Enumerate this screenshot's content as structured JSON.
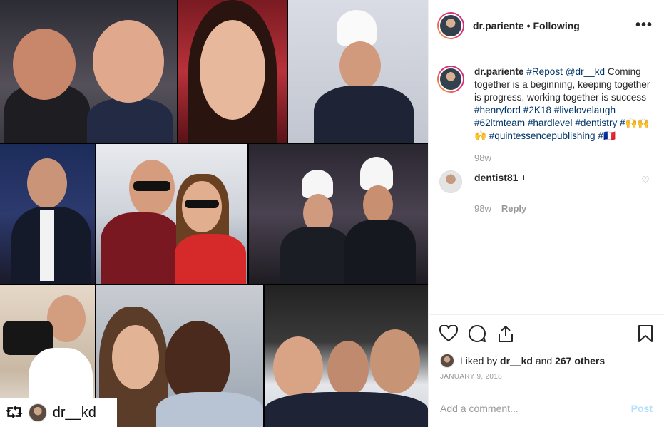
{
  "photo": {
    "repost_user": "dr__kd",
    "repost_icon": "repost-icon"
  },
  "header": {
    "username": "dr.pariente",
    "separator": "•",
    "follow_status": "Following",
    "more_label": "•••"
  },
  "caption": {
    "username": "dr.pariente",
    "parts": [
      {
        "text": "#Repost",
        "link": true
      },
      {
        "text": " ",
        "link": false
      },
      {
        "text": "@dr__kd",
        "link": true
      },
      {
        "text": " Coming together is a beginning, keeping together is progress, working together is success ",
        "link": false
      },
      {
        "text": "#henryford",
        "link": true
      },
      {
        "text": " ",
        "link": false
      },
      {
        "text": "#2K18",
        "link": true
      },
      {
        "text": " ",
        "link": false
      },
      {
        "text": "#livelovelaugh",
        "link": true
      },
      {
        "text": " ",
        "link": false
      },
      {
        "text": "#62ltmteam",
        "link": true
      },
      {
        "text": " ",
        "link": false
      },
      {
        "text": "#hardlevel",
        "link": true
      },
      {
        "text": " ",
        "link": false
      },
      {
        "text": "#dentistry",
        "link": true
      },
      {
        "text": " ",
        "link": false
      },
      {
        "text": "#",
        "link": true
      },
      {
        "text": "🙌🙌🙌",
        "link": false
      },
      {
        "text": " ",
        "link": false
      },
      {
        "text": "#quintessencepublishing",
        "link": true
      },
      {
        "text": " ",
        "link": false
      },
      {
        "text": "#🇫🇷",
        "link": true
      }
    ],
    "time": "98w"
  },
  "comment": {
    "username": "dentist81",
    "text": "+",
    "time": "98w",
    "reply_label": "Reply"
  },
  "actions": {
    "icons": [
      "heart-icon",
      "comment-icon",
      "share-icon",
      "bookmark-icon"
    ]
  },
  "likes": {
    "prefix": "Liked by",
    "user": "dr__kd",
    "and": "and",
    "others": "267 others"
  },
  "date": "JANUARY 9, 2018",
  "add_comment": {
    "placeholder": "Add a comment...",
    "post_label": "Post"
  }
}
